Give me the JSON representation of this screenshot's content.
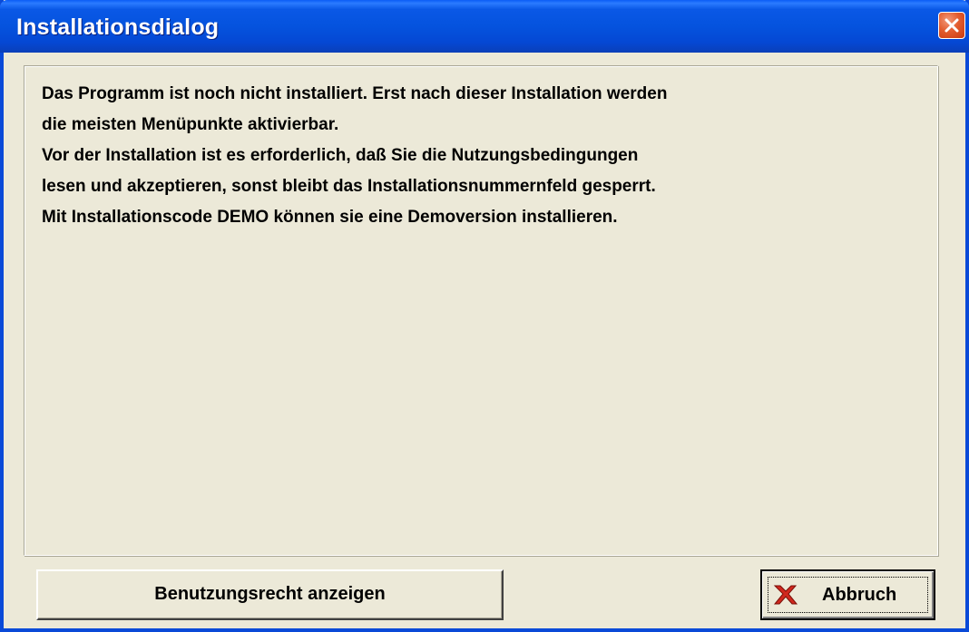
{
  "window": {
    "title": "Installationsdialog"
  },
  "message": {
    "lines": [
      "Das Programm ist noch nicht installiert. Erst nach dieser Installation werden",
      "die meisten Menüpunkte aktivierbar.",
      "Vor der Installation ist es erforderlich, daß Sie die Nutzungsbedingungen",
      "lesen und akzeptieren, sonst bleibt das Installationsnummernfeld gesperrt.",
      "Mit Installationscode DEMO können sie eine Demoversion installieren."
    ]
  },
  "buttons": {
    "show_license_label": "Benutzungsrecht anzeigen",
    "cancel_label": "Abbruch"
  },
  "icons": {
    "close": "close-icon",
    "cancel": "red-x-icon"
  },
  "colors": {
    "titlebar": "#0553de",
    "window_face": "#ece9d8",
    "close_button": "#e35d2f",
    "cancel_icon": "#d0281e"
  }
}
